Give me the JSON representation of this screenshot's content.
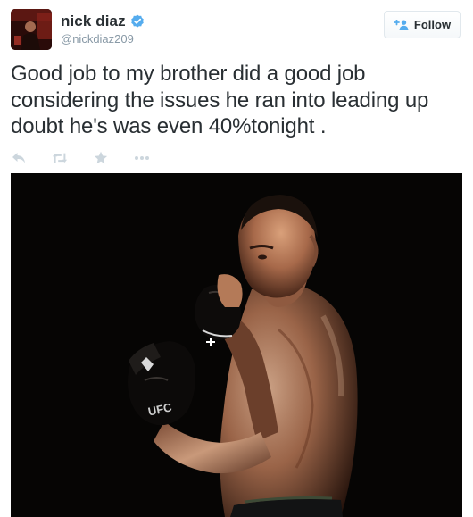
{
  "user": {
    "name": "nick diaz",
    "handle": "@nickdiaz209",
    "verified": true
  },
  "follow_button": {
    "label": "Follow",
    "icon": "plus-user-icon"
  },
  "tweet": {
    "text": "Good job to my brother did a good job considering the issues he ran into leading up doubt he's was even 40%tonight ."
  },
  "actions": [
    {
      "name": "reply",
      "icon": "reply-icon"
    },
    {
      "name": "retweet",
      "icon": "retweet-icon"
    },
    {
      "name": "favorite",
      "icon": "star-icon"
    },
    {
      "name": "more",
      "icon": "more-dots-icon"
    }
  ],
  "media": {
    "glove_text": "UFC"
  },
  "colors": {
    "verified": "#55acee",
    "text": "#292f33",
    "muted": "#8899a6",
    "action_icon": "#ccd6dd"
  }
}
